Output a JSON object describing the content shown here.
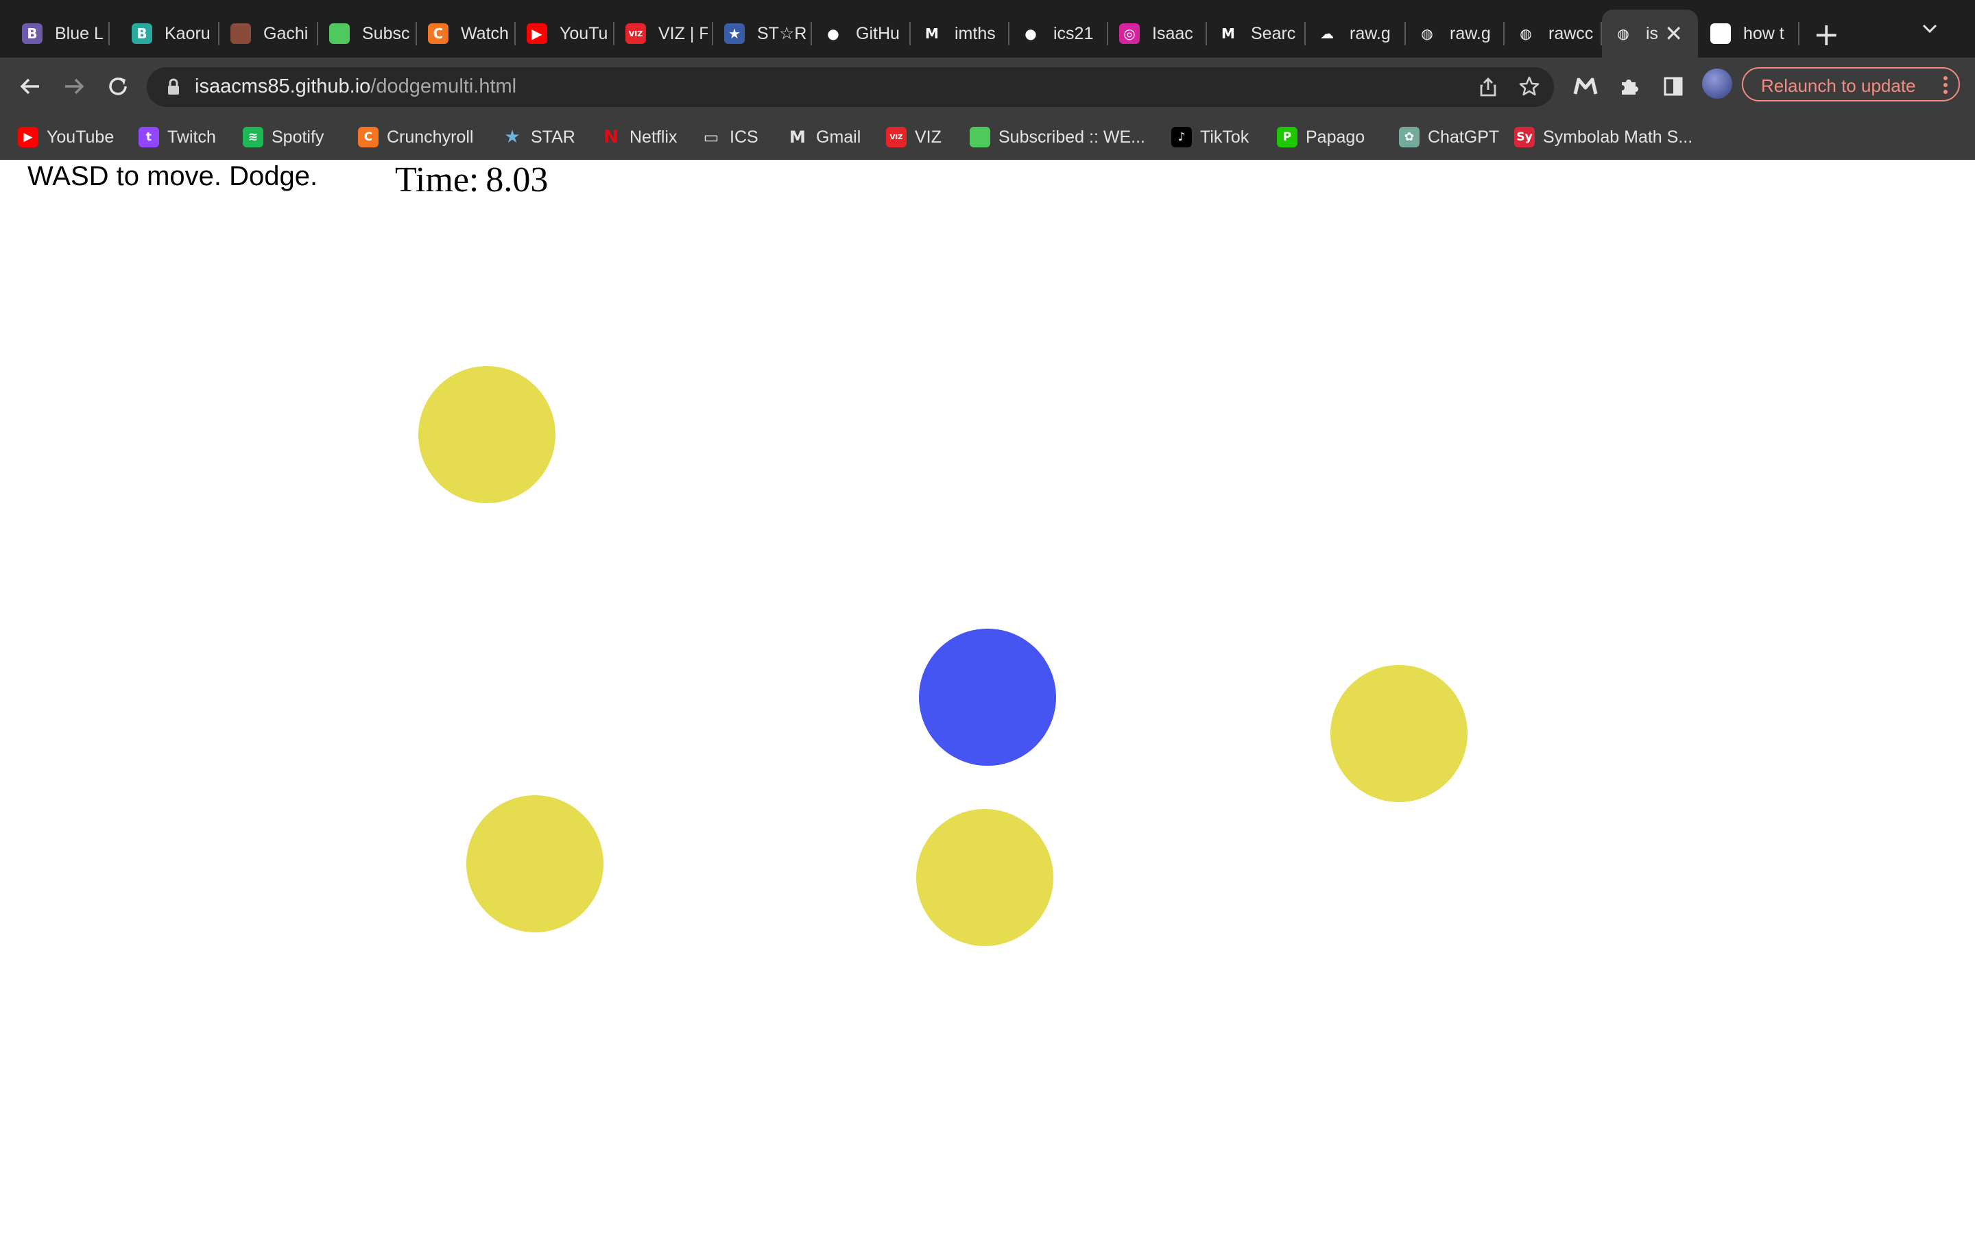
{
  "browser": {
    "tabs": [
      {
        "title": "Blue L",
        "icon": "blue-lock-icon",
        "color": "#6b5ba8",
        "glyph": "B"
      },
      {
        "title": "Kaoru",
        "icon": "bookwalker-icon",
        "color": "#2aa9a0",
        "glyph": "B"
      },
      {
        "title": "Gachi",
        "icon": "gachi-thumbnail-icon",
        "color": "#8a4b3a",
        "glyph": ""
      },
      {
        "title": "Subsc",
        "icon": "webtoon-icon",
        "color": "#4fc95e",
        "glyph": ""
      },
      {
        "title": "Watch",
        "icon": "crunchyroll-icon",
        "color": "#f47521",
        "glyph": "C"
      },
      {
        "title": "YouTu",
        "icon": "youtube-icon",
        "color": "#ff0000",
        "glyph": "▶"
      },
      {
        "title": "VIZ | F",
        "icon": "viz-icon",
        "color": "#e8242b",
        "glyph": "VIZ"
      },
      {
        "title": "ST☆R",
        "icon": "star-site-icon",
        "color": "#3a5da8",
        "glyph": "★"
      },
      {
        "title": "GitHu",
        "icon": "github-icon",
        "color": "#1f1f1f",
        "glyph": "●"
      },
      {
        "title": "imths",
        "icon": "gmail-icon",
        "color": "#1f1f1f",
        "glyph": "M"
      },
      {
        "title": "ics21",
        "icon": "github-icon",
        "color": "#1f1f1f",
        "glyph": "●"
      },
      {
        "title": "Isaac",
        "icon": "instagram-icon",
        "color": "#d6249f",
        "glyph": "◎"
      },
      {
        "title": "Searc",
        "icon": "gmail-icon",
        "color": "#1f1f1f",
        "glyph": "M"
      },
      {
        "title": "raw.g",
        "icon": "cloud-icon",
        "color": "#1f1f1f",
        "glyph": "☁"
      },
      {
        "title": "raw.g",
        "icon": "globe-icon",
        "color": "#1f1f1f",
        "glyph": "◍"
      },
      {
        "title": "rawcc",
        "icon": "globe-icon",
        "color": "#1f1f1f",
        "glyph": "◍"
      },
      {
        "title": "is",
        "icon": "globe-icon",
        "color": "#3c3c3c",
        "glyph": "◍",
        "active": true
      },
      {
        "title": "how t",
        "icon": "google-icon",
        "color": "#ffffff",
        "glyph": "G"
      }
    ],
    "new_tab_label": "+",
    "url_host": "isaacms85.github.io",
    "url_path": "/dodgemulti.html",
    "relaunch_label": "Relaunch to update",
    "bookmarks": [
      {
        "label": "YouTube",
        "icon": "youtube-icon",
        "color": "#ff0000",
        "glyph": "▶"
      },
      {
        "label": "Twitch",
        "icon": "twitch-icon",
        "color": "#9146ff",
        "glyph": "t"
      },
      {
        "label": "Spotify",
        "icon": "spotify-icon",
        "color": "#1db954",
        "glyph": "≋"
      },
      {
        "label": "Crunchyroll",
        "icon": "crunchyroll-icon",
        "color": "#f47521",
        "glyph": "C"
      },
      {
        "label": "STAR",
        "icon": "star-icon",
        "color": "#3c3c3c",
        "glyph": "★"
      },
      {
        "label": "Netflix",
        "icon": "netflix-icon",
        "color": "#3c3c3c",
        "glyph": "N"
      },
      {
        "label": "ICS",
        "icon": "folder-icon",
        "color": "#3c3c3c",
        "glyph": "▭"
      },
      {
        "label": "Gmail",
        "icon": "gmail-icon",
        "color": "#3c3c3c",
        "glyph": "M"
      },
      {
        "label": "VIZ",
        "icon": "viz-icon",
        "color": "#e8242b",
        "glyph": "VIZ"
      },
      {
        "label": "Subscribed :: WE...",
        "icon": "webtoon-icon",
        "color": "#4fc95e",
        "glyph": ""
      },
      {
        "label": "TikTok",
        "icon": "tiktok-icon",
        "color": "#000000",
        "glyph": "♪"
      },
      {
        "label": "Papago",
        "icon": "papago-icon",
        "color": "#1ec800",
        "glyph": "P"
      },
      {
        "label": "ChatGPT",
        "icon": "chatgpt-icon",
        "color": "#74aa9c",
        "glyph": "✿"
      },
      {
        "label": "Symbolab Math S...",
        "icon": "symbolab-icon",
        "color": "#d8263b",
        "glyph": "Sy"
      }
    ]
  },
  "game": {
    "instructions": "WASD to move. Dodge.",
    "timer_label": "Time:",
    "timer_value": "8.03",
    "player_color": "#4654f2",
    "enemy_color": "#e6dc50"
  }
}
